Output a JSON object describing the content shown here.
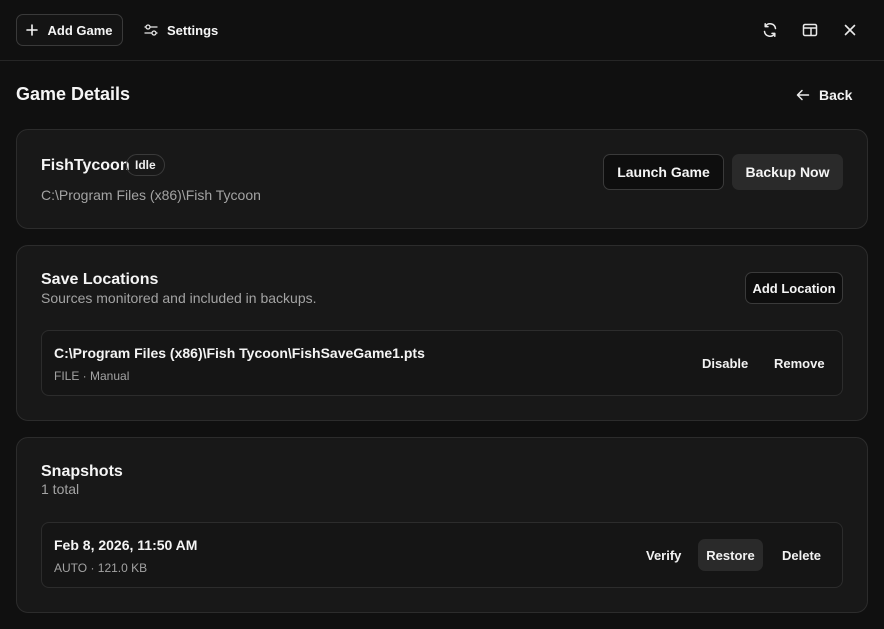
{
  "topbar": {
    "add_game_label": "Add Game",
    "settings_label": "Settings",
    "icons": [
      "plus-icon",
      "sliders-icon",
      "refresh-icon",
      "layout-icon",
      "close-icon"
    ]
  },
  "page": {
    "title": "Game Details",
    "back_label": "Back"
  },
  "game": {
    "name": "FishTycoon",
    "status": "Idle",
    "path": "C:\\Program Files (x86)\\Fish Tycoon",
    "launch_label": "Launch Game",
    "backup_label": "Backup Now"
  },
  "save_locations": {
    "title": "Save Locations",
    "subtitle": "Sources monitored and included in backups.",
    "add_label": "Add Location",
    "items": [
      {
        "path": "C:\\Program Files (x86)\\Fish Tycoon\\FishSaveGame1.pts",
        "meta": "FILE · Manual",
        "disable_label": "Disable",
        "remove_label": "Remove"
      }
    ]
  },
  "snapshots": {
    "title": "Snapshots",
    "count_text": "1 total",
    "items": [
      {
        "date": "Feb 8, 2026, 11:50 AM",
        "meta": "AUTO · 121.0 KB",
        "verify_label": "Verify",
        "restore_label": "Restore",
        "delete_label": "Delete"
      }
    ]
  },
  "colors": {
    "background": "#101010",
    "card": "#181818",
    "border": "#2c2c2c",
    "muted_text": "#a3a3a3"
  }
}
